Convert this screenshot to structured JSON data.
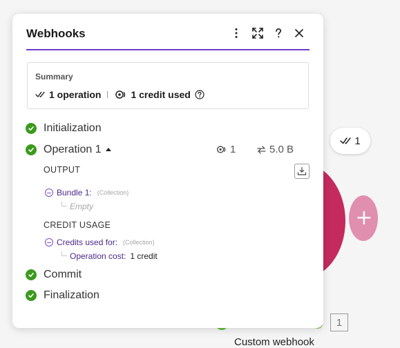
{
  "panel": {
    "title": "Webhooks",
    "header_icons": [
      "more-vertical-icon",
      "expand-icon",
      "help-icon",
      "close-icon"
    ]
  },
  "summary": {
    "title": "Summary",
    "operations": "1 operation",
    "credits": "1 credit used"
  },
  "steps": {
    "initialization": "Initialization",
    "operation": "Operation 1",
    "commit": "Commit",
    "finalization": "Finalization"
  },
  "operation_stats": {
    "credits": "1",
    "size": "5.0 B"
  },
  "output": {
    "label": "OUTPUT",
    "bundle_key": "Bundle 1:",
    "bundle_type": "(Collection)",
    "bundle_value": "Empty"
  },
  "credit_usage": {
    "label": "CREDIT USAGE",
    "key": "Credits used for:",
    "type": "(Collection)",
    "cost_key": "Operation cost:",
    "cost_value": "1 credit"
  },
  "canvas": {
    "ops_chip_count": "1",
    "module_count": "1",
    "module_label": "Custom webhook"
  },
  "colors": {
    "accent": "#6c3ac8",
    "success": "#3c9a1e",
    "module": "#c42a5d",
    "module_light": "#e08fae"
  }
}
